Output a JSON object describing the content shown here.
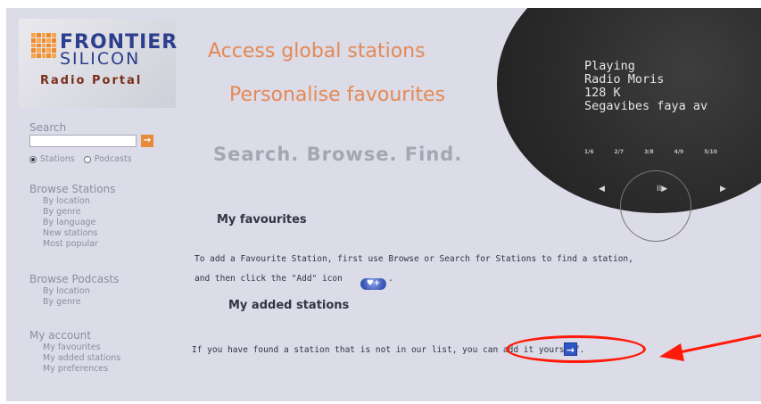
{
  "logo": {
    "line1": "FRONTIER",
    "line2": "SILICON",
    "line3": "Radio Portal"
  },
  "search": {
    "label": "Search",
    "value": "",
    "go_label": "→",
    "radio_stations": "Stations",
    "radio_podcasts": "Podcasts",
    "selected": "Stations"
  },
  "sidebar": {
    "browse_stations": {
      "title": "Browse Stations",
      "items": [
        "By location",
        "By genre",
        "By language",
        "New stations",
        "Most popular"
      ]
    },
    "browse_podcasts": {
      "title": "Browse Podcasts",
      "items": [
        "By location",
        "By genre"
      ]
    },
    "my_account": {
      "title": "My account",
      "items": [
        "My favourites",
        "My added stations",
        "My preferences"
      ]
    }
  },
  "headlines": {
    "access": "Access global stations",
    "personalise": "Personalise favourites",
    "tagline": "Search. Browse. Find."
  },
  "display": {
    "lines": [
      "Playing",
      "Radio Moris",
      "128 K",
      "Segavibes faya av"
    ],
    "presets": [
      "1/6",
      "2/7",
      "3/8",
      "4/9",
      "5/10"
    ],
    "ctrl_prev": "◀",
    "ctrl_play": "II▶",
    "ctrl_next": "▶"
  },
  "main": {
    "favourites_title": "My favourites",
    "fav_text_1": "To add a Favourite Station, first use Browse or Search for Stations to find a station,",
    "fav_text_2": "and then   click the \"Add\" icon",
    "fav_text_2_end": ".",
    "add_icon_label": "♥+",
    "added_title": "My added stations",
    "added_text": "If you have found a station that is not in our list, you can add it yourself.",
    "add_station_label": "→"
  },
  "annotation": {
    "color": "#ff1a0a"
  },
  "colors": {
    "accent_orange": "#e38a55",
    "brand_blue": "#2d3e8c",
    "page_bg": "#dcdbe8"
  }
}
